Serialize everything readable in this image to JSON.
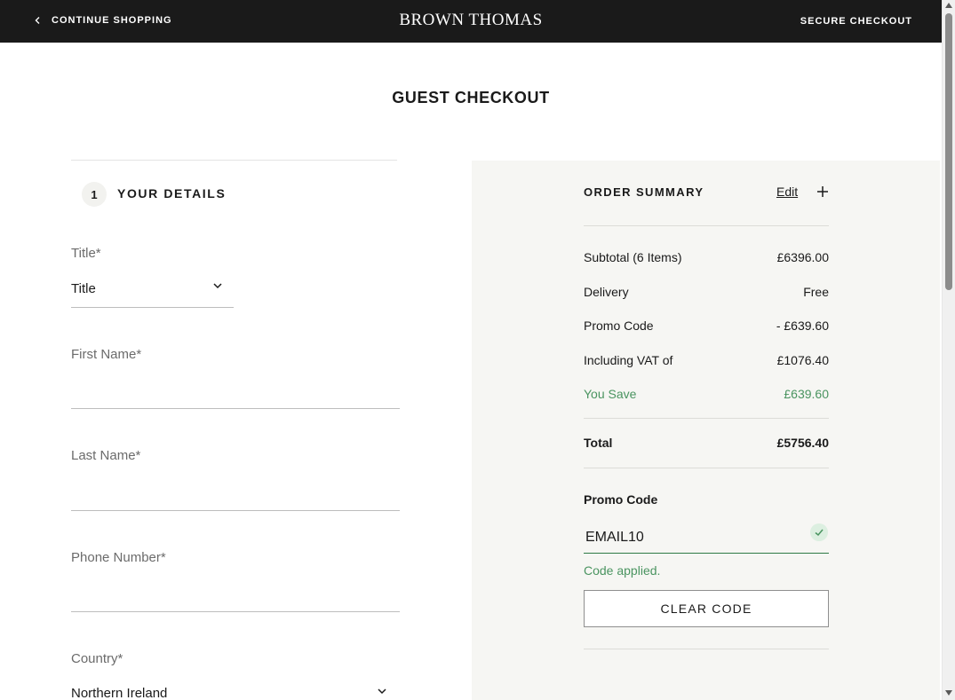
{
  "header": {
    "continue_label": "CONTINUE SHOPPING",
    "brand": "BROWN THOMAS",
    "secure_label": "SECURE CHECKOUT",
    "background": "#1a1a1a"
  },
  "page": {
    "title": "GUEST CHECKOUT"
  },
  "details": {
    "step_number": "1",
    "step_title": "YOUR DETAILS",
    "title_label": "Title*",
    "title_value": "Title",
    "first_name_label": "First Name*",
    "last_name_label": "Last Name*",
    "phone_label": "Phone Number*",
    "country_label": "Country*",
    "country_value": "Northern Ireland"
  },
  "summary": {
    "title": "ORDER SUMMARY",
    "edit_label": "Edit",
    "rows": [
      {
        "label": "Subtotal (6 Items)",
        "value": "£6396.00"
      },
      {
        "label": "Delivery",
        "value": "Free"
      },
      {
        "label": "Promo Code",
        "value": "- £639.60"
      },
      {
        "label": "Including VAT of",
        "value": "£1076.40"
      },
      {
        "label": "You Save",
        "value": "£639.60"
      }
    ],
    "total_label": "Total",
    "total_value": "£5756.40",
    "promo_label": "Promo Code",
    "promo_value": "EMAIL10",
    "code_applied": "Code applied.",
    "clear_label": "CLEAR CODE",
    "accent_green": "#4a9460"
  }
}
